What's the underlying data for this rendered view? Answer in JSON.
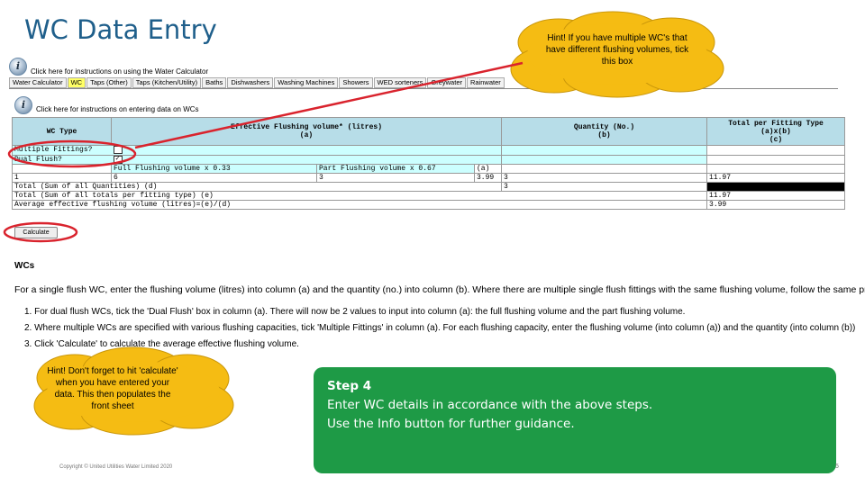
{
  "slide_title": "WC Data Entry",
  "top_link": "Click here for instructions on using the Water Calculator",
  "tabs": [
    "Water Calculator",
    "WC",
    "Taps (Other)",
    "Taps (Kitchen/Utility)",
    "Baths",
    "Dishwashers",
    "Washing Machines",
    "Showers",
    "WED sorteners",
    "Greywater",
    "Rainwater"
  ],
  "sub_link": "Click here for instructions on entering data on WCs",
  "table": {
    "h1": "WC Type",
    "h2": "Effective Flushing volume* (litres)",
    "h2b": "(a)",
    "h3": "Quantity (No.)",
    "h3b": "(b)",
    "h4": "Total per Fitting Type",
    "h4b": "(a)x(b)",
    "h4c": "(c)",
    "multiple": "Multiple Fittings?",
    "dual": "Dual Flush?",
    "full": "Full Flushing volume x 0.33",
    "part": "Part Flushing volume x 0.67",
    "a_label": "(a)",
    "row1_type": "1",
    "row1_full": "6",
    "row1_part": "3",
    "row1_a": "3.99",
    "row1_qty": "3",
    "row1_total": "11.97",
    "total_qty_label": "Total (Sum of all Quantities) (d)",
    "total_qty": "3",
    "total_totals_label": "Total (Sum of all totals per fitting type) (e)",
    "total_totals": "11.97",
    "avg_label": "Average effective flushing volume (litres)=(e)/(d)",
    "avg": "3.99"
  },
  "calculate_button": "Calculate",
  "instructions": {
    "heading": "WCs",
    "para": "For a single flush WC, enter the flushing volume (litres) into column (a) and the quantity (no.) into column (b). Where there are multiple single flush fittings with the same flushing volume, follow the same procedure.",
    "item1": "1.  For dual flush WCs, tick the 'Dual Flush' box in column (a). There will now be 2 values to input into column (a): the full flushing volume and the part flushing volume.",
    "item2": "2.  Where multiple WCs are specified with various flushing capacities, tick 'Multiple Fittings' in column (a). For each flushing capacity, enter the flushing volume (into column (a)) and the quantity (into column (b))",
    "item3": "3.  Click 'Calculate' to calculate the average effective flushing volume."
  },
  "hint_top": "Hint! If you have multiple WC's that have different flushing volumes, tick this box",
  "hint_bottom": "Hint! Don't forget to hit 'calculate' when you have entered your data. This then populates the front sheet",
  "step4": {
    "title": "Step 4",
    "line1": "Enter WC details in accordance with the above steps.",
    "line2": "Use the Info button for further guidance."
  },
  "copyright": "Copyright © United Utilities Water Limited 2020",
  "page_number": "5",
  "colors": {
    "title": "#1f5f8b",
    "hint_cloud": "#f5bc13",
    "step_box": "#1e9a46",
    "highlight_circle": "#d9232d",
    "table_header": "#b7dde8"
  }
}
